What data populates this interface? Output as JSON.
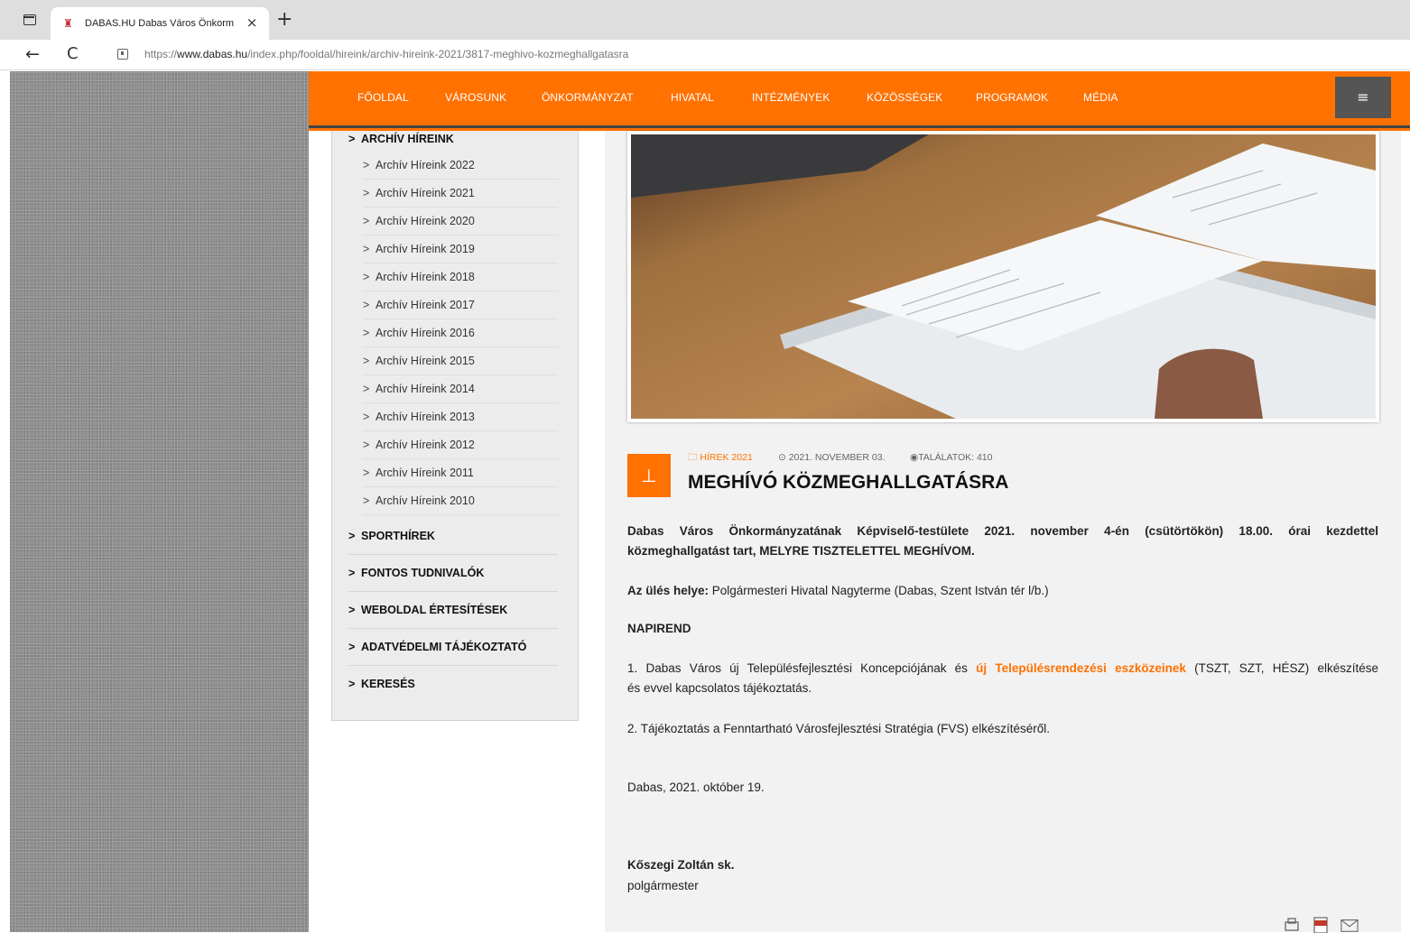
{
  "browser": {
    "tab_title": "DABAS.HU Dabas Város Önkorm",
    "tab_close": "×",
    "new_tab": "+",
    "back": "←",
    "reload": "C",
    "url_prefix": "https://",
    "url_host": "www.dabas.hu",
    "url_path": "/index.php/fooldal/hireink/archiv-hireink-2021/3817-meghivo-kozmeghallgatasra"
  },
  "nav": {
    "items": [
      "FŐOLDAL",
      "VÁROSUNK",
      "ÖNKORMÁNYZAT",
      "HIVATAL",
      "INTÉZMÉNYEK",
      "KÖZÖSSÉGEK",
      "PROGRAMOK",
      "MÉDIA"
    ],
    "menu_icon": "hamburger-icon",
    "menu_glyph": "≡"
  },
  "sidebar": {
    "chevron": ">",
    "header": "ARCHÍV HÍREINK",
    "sub_items": [
      "Archív Híreink 2022",
      "Archív Híreink 2021",
      "Archív Híreink 2020",
      "Archív Híreink 2019",
      "Archív Híreink 2018",
      "Archív Híreink 2017",
      "Archív Híreink 2016",
      "Archív Híreink 2015",
      "Archív Híreink 2014",
      "Archív Híreink 2013",
      "Archív Híreink 2012",
      "Archív Híreink 2011",
      "Archív Híreink 2010"
    ],
    "main_items": [
      "SPORTHÍREK",
      "FONTOS TUDNIVALÓK",
      "WEBOLDAL ÉRTESÍTÉSEK",
      "ADATVÉDELMI TÁJÉKOZTATÓ",
      "KERESÉS"
    ]
  },
  "article": {
    "category": "HÍREK 2021",
    "date": "2021. NOVEMBER 03.",
    "hits": "TALÁLATOK: 410",
    "title": "MEGHÍVÓ KÖZMEGHALLGATÁSRA",
    "intro_line1": "Dabas Város Önkormányzatának Képviselő-testülete 2021. november 4-én (csütörtökön)  18.00. órai kezdettel",
    "intro_line2": "közmeghallgatást tart,  MELYRE TISZTELETTEL MEGHÍVOM.",
    "location_label": "Az ülés helye:",
    "location_value": " Polgármesteri Hivatal Nagyterme (Dabas, Szent István tér l/b.)",
    "agenda_heading": "NAPIREND",
    "item1_pre": "1. Dabas Város új Településfejlesztési Koncepciójának és ",
    "item1_link": "új Településrendezési eszközeinek",
    "item1_post": " (TSZT, SZT, HÉSZ) elkészítése",
    "item1_line2": "és evvel kapcsolatos tájékoztatás.",
    "item2": "2.   Tájékoztatás a Fenntartható Városfejlesztési Stratégia (FVS) elkészítéséről.",
    "place_date": "Dabas, 2021. október 19.",
    "signer": "Kőszegi Zoltán sk.",
    "signer_title": "polgármester"
  },
  "colors": {
    "accent": "#ff7100",
    "nav_dark": "#555555"
  }
}
